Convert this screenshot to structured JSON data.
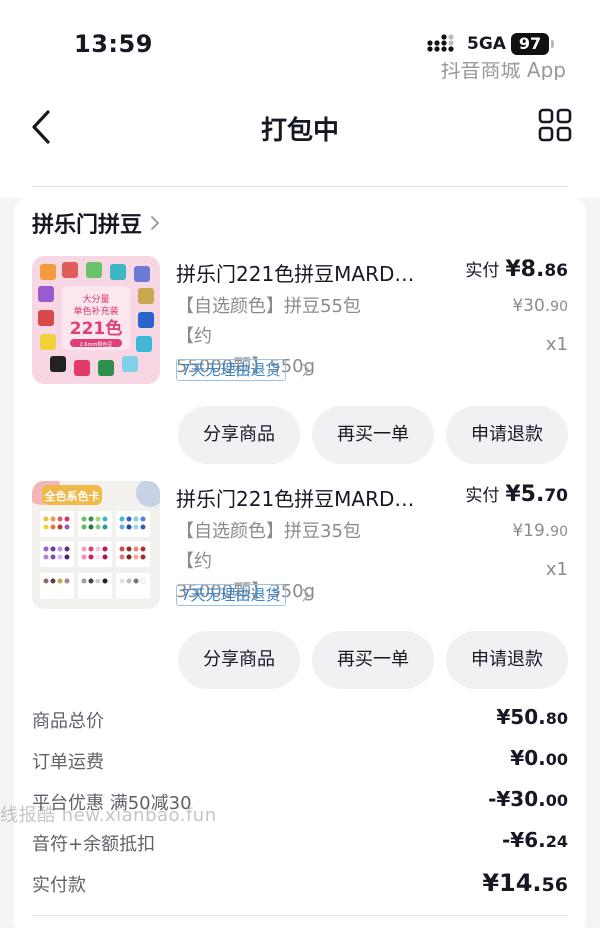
{
  "status": {
    "time": "13:59",
    "network": "5GA",
    "battery": "97"
  },
  "nav": {
    "title": "打包中",
    "app_hint": "抖音商城 App"
  },
  "shop": {
    "name": "拼乐门拼豆"
  },
  "items": [
    {
      "name": "拼乐门221色拼豆MARD…",
      "paid_label": "实付",
      "paid_int": "¥8.",
      "paid_dec": "86",
      "spec_line1": "【自选颜色】拼豆55包【约",
      "spec_line2": "55000颗】550g",
      "orig_int": "¥30.",
      "orig_dec": "90",
      "qty": "x1",
      "return_tag": "7天无理由退货",
      "buttons": [
        "分享商品",
        "再买一单",
        "申请退款"
      ],
      "thumb_text": [
        "大分量",
        "单色补充装",
        "221色",
        "2.6mm颗色豆"
      ]
    },
    {
      "name": "拼乐门221色拼豆MARD…",
      "paid_label": "实付",
      "paid_int": "¥5.",
      "paid_dec": "70",
      "spec_line1": "【自选颜色】拼豆35包【约",
      "spec_line2": "35000颗】350g",
      "orig_int": "¥19.",
      "orig_dec": "90",
      "qty": "x1",
      "return_tag": "7天无理由退货",
      "buttons": [
        "分享商品",
        "再买一单",
        "申请退款"
      ],
      "thumb_text": [
        "全色系色卡"
      ]
    }
  ],
  "summary": [
    {
      "label": "商品总价",
      "int": "¥50.",
      "dec": "80"
    },
    {
      "label": "订单运费",
      "int": "¥0.",
      "dec": "00"
    },
    {
      "label": "平台优惠  满50减30",
      "int": "-¥30.",
      "dec": "00"
    },
    {
      "label": "音符+余额抵扣",
      "int": "-¥6.",
      "dec": "24"
    },
    {
      "label": "实付款",
      "int": "¥14.",
      "dec": "56"
    }
  ],
  "watermark": "线报酷 new.xianbao.fun",
  "colors": {
    "accent_blue": "#3a86c8",
    "muted": "#8a8b91",
    "text": "#161823"
  }
}
